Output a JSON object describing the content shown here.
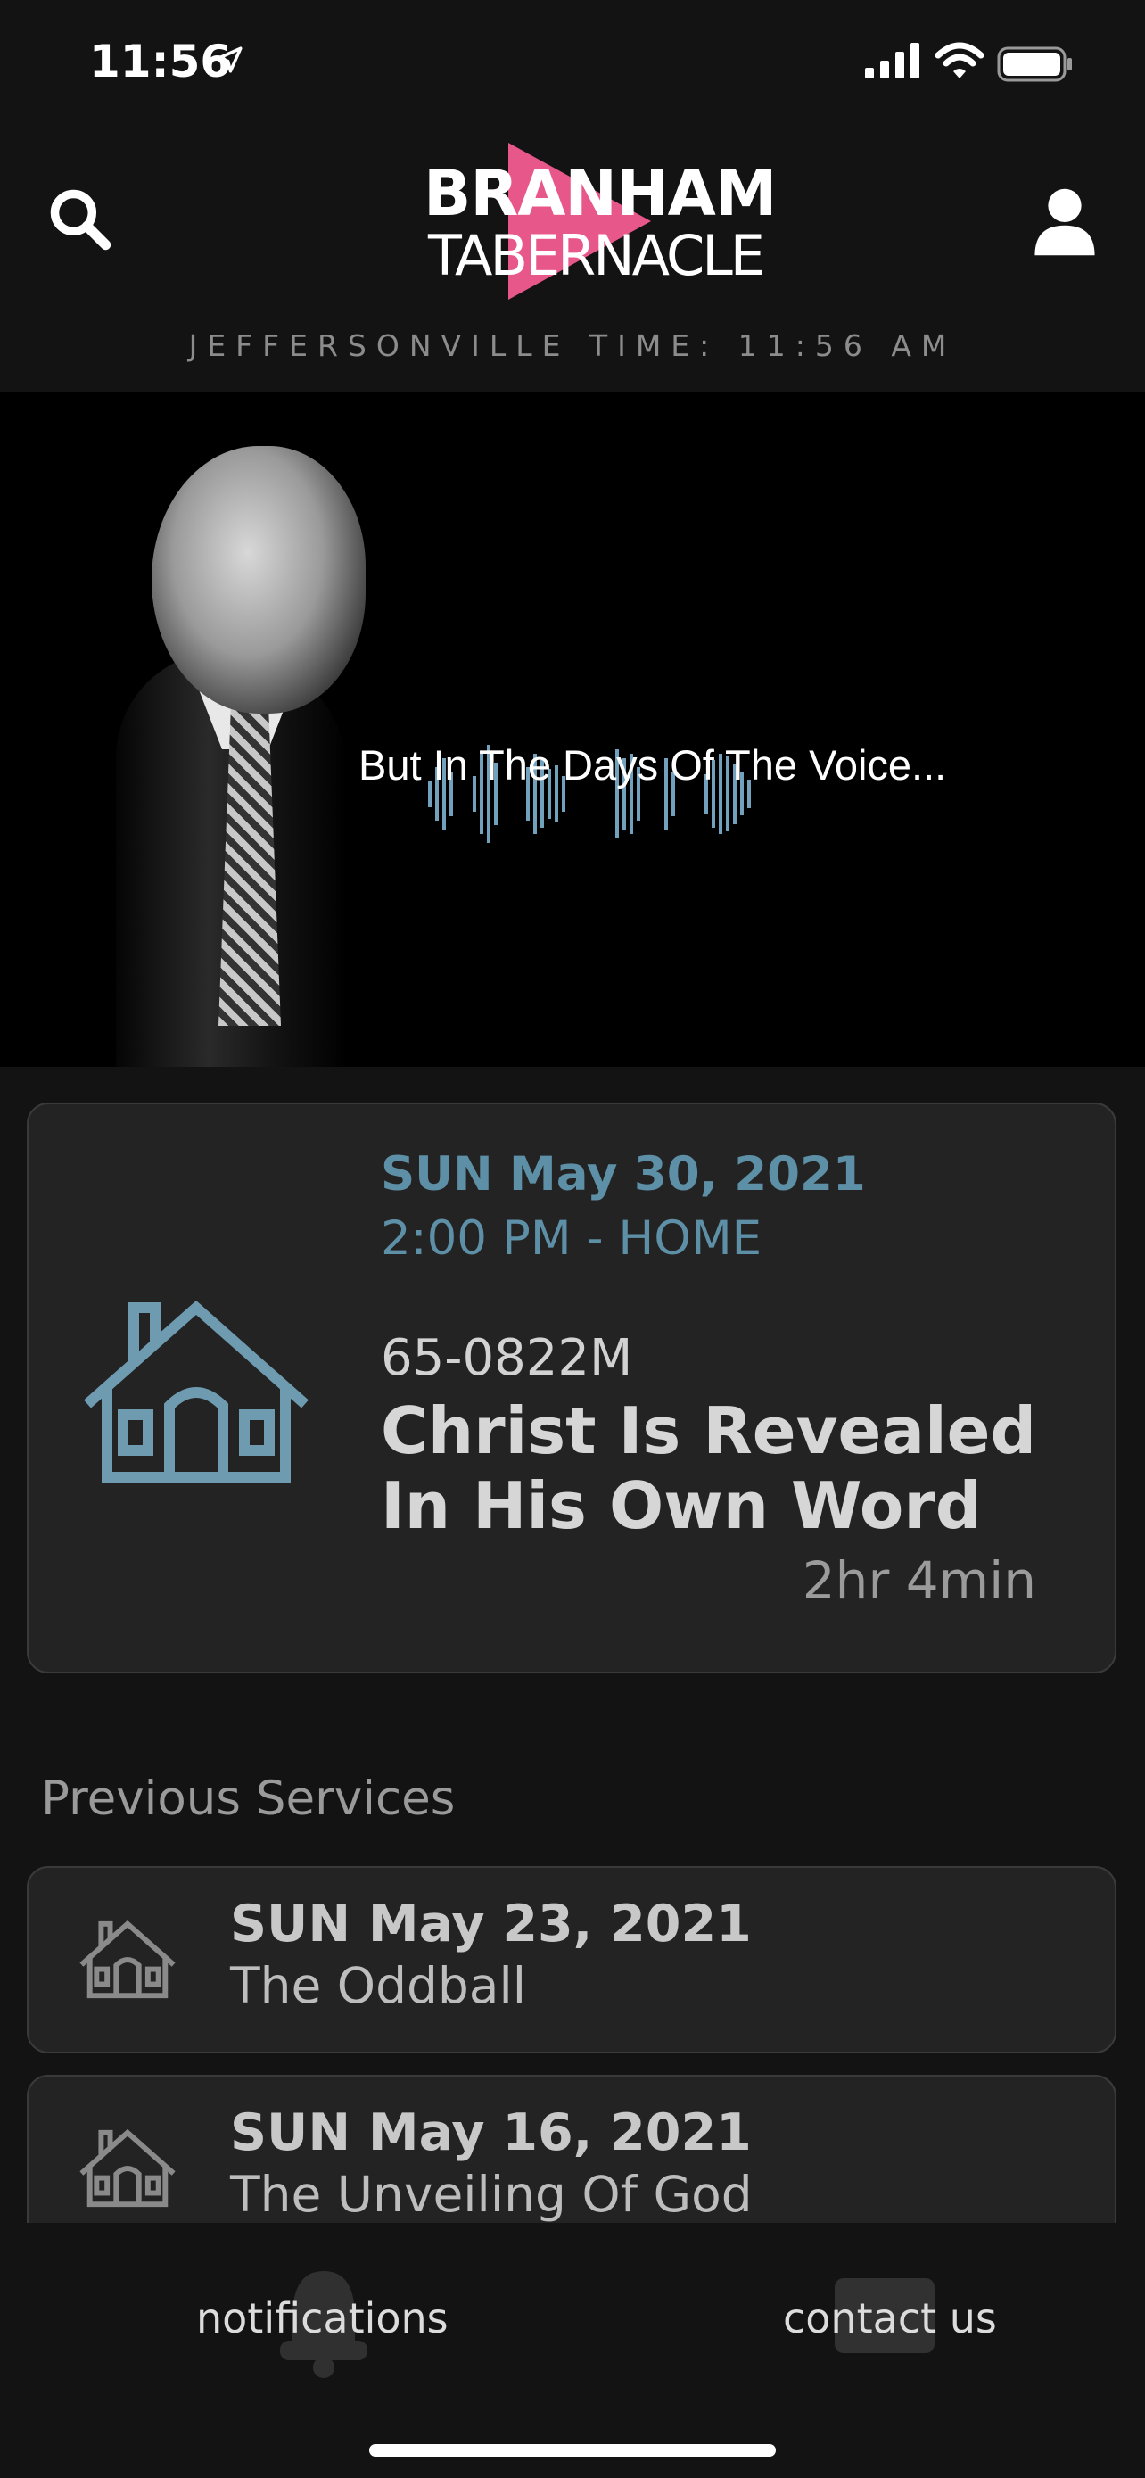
{
  "status_bar": {
    "time": "11:56"
  },
  "header": {
    "logo_line1": "BRANHAM",
    "logo_line2": "TABERNACLE",
    "jeffersonville_time": "JEFFERSONVILLE TIME: 11:56 AM"
  },
  "hero": {
    "caption": "But In The Days Of The Voice..."
  },
  "current_service": {
    "date": "SUN May 30, 2021",
    "time_location": "2:00 PM - HOME",
    "code": "65-0822M",
    "title": "Christ Is Revealed In His Own Word",
    "duration": "2hr 4min"
  },
  "previous": {
    "heading": "Previous Services",
    "items": [
      {
        "date": "SUN May 23, 2021",
        "title": "The Oddball"
      },
      {
        "date": "SUN May 16, 2021",
        "title": "The Unveiling Of God"
      }
    ]
  },
  "tabbar": {
    "notifications": "notifications",
    "contact": "contact us"
  },
  "colors": {
    "accent": "#5d8fa6",
    "logo_pink": "#e8578a",
    "background": "#131313"
  }
}
